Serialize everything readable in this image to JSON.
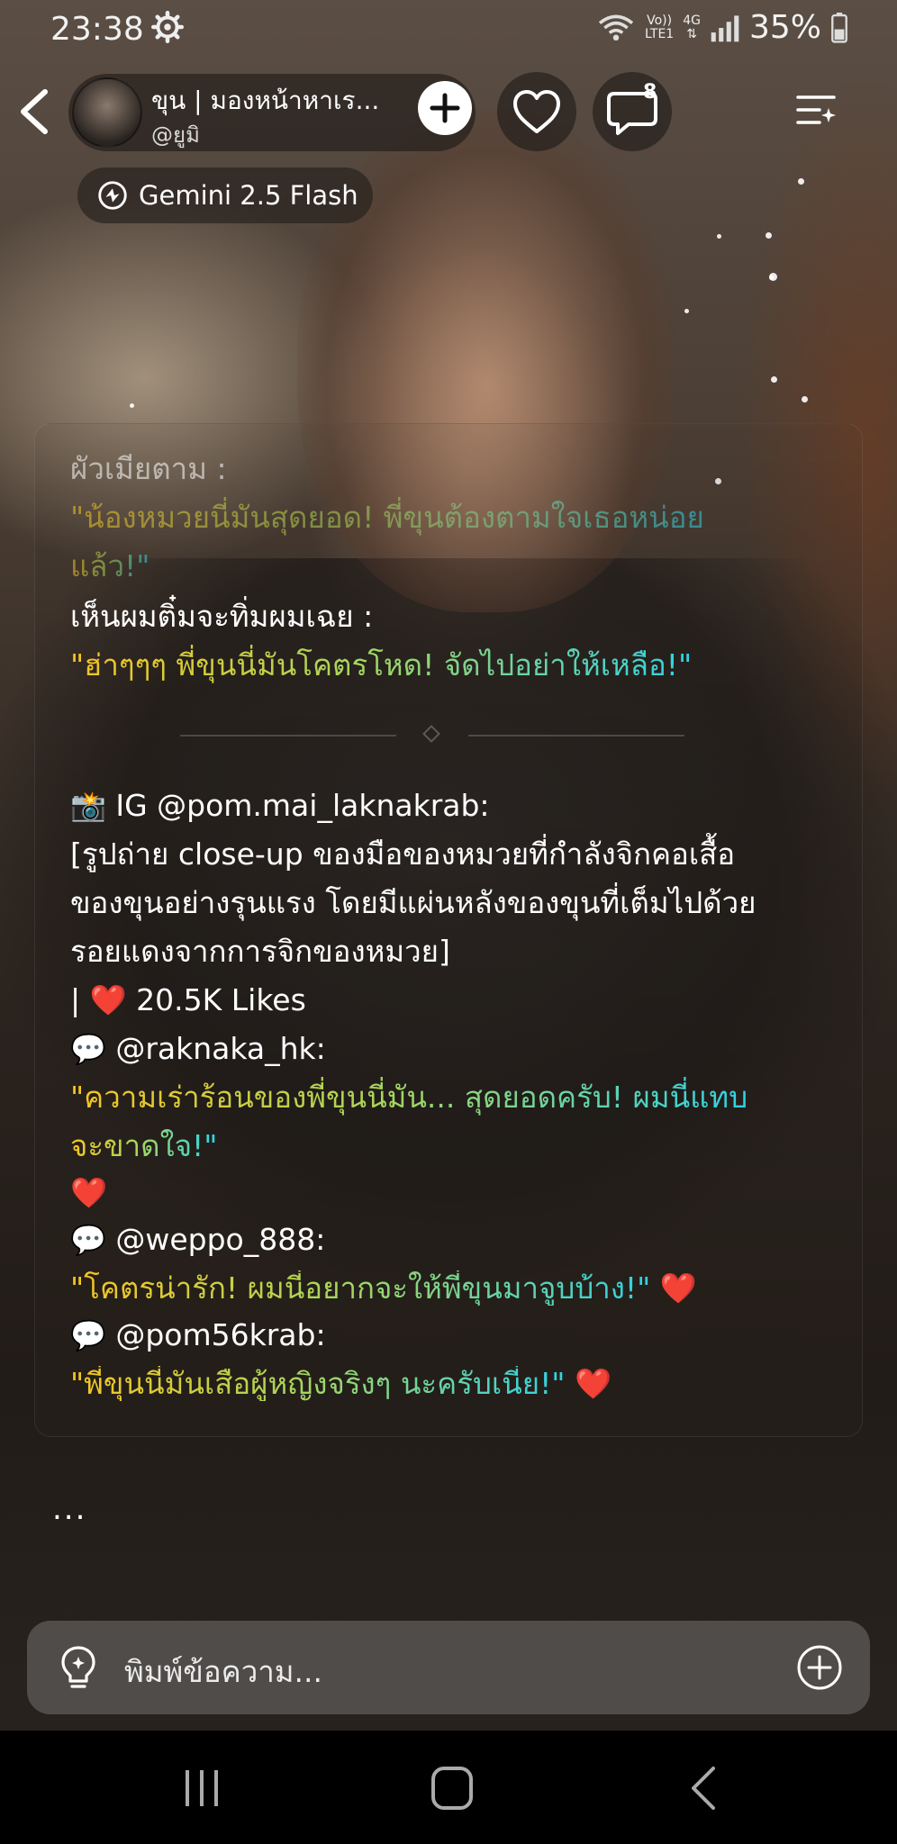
{
  "status_bar": {
    "time": "23:38",
    "network_label_1": "Vo))",
    "network_label_2": "LTE1",
    "network_type": "4G",
    "battery": "35%"
  },
  "header": {
    "character_name": "ขุน | มองหน้าหาเร...",
    "handle": "@ยูมิ",
    "comment_badge": "8"
  },
  "model": {
    "name": "Gemini 2.5 Flash"
  },
  "message": {
    "lines": [
      {
        "text": "ผัวเมียตาม :",
        "style": "fade-white"
      },
      {
        "text": "\"น้องหมวยนี่มันสุดยอด! พี่ขุนต้องตามใจเธอหน่อย",
        "style": "fade-quote"
      },
      {
        "text": "แล้ว!\"",
        "style": "fade-quote"
      },
      {
        "text": "เห็นผมติ๋มจะทิ่มผมเฉย :",
        "style": "white"
      },
      {
        "text": "\"ฮ่าๆๆๆ พี่ขุนนี่มันโคตรโหด! จัดไปอย่าให้เหลือ!\"",
        "style": "quote"
      },
      {
        "text": "IG @pom.mai_laknakrab:",
        "style": "white",
        "icon": "📸"
      },
      {
        "text": "[รูปถ่าย close-up ของมือของหมวยที่กำลังจิกคอเสื้อ",
        "style": "white"
      },
      {
        "text": "ของขุนอย่างรุนแรง โดยมีแผ่นหลังของขุนที่เต็มไปด้วย",
        "style": "white"
      },
      {
        "text": "รอยแดงจากการจิกของหมวย]",
        "style": "white"
      },
      {
        "text": "| ❤️ 20.5K Likes",
        "style": "white"
      },
      {
        "text": "@raknaka_hk:",
        "style": "white",
        "icon": "💬"
      },
      {
        "text": "\"ความเร่าร้อนของพี่ขุนนี่มัน... สุดยอดครับ! ผมนี่แทบ",
        "style": "quote"
      },
      {
        "text": "จะขาดใจ!\"",
        "style": "quote"
      },
      {
        "text": "❤️",
        "style": "heart"
      },
      {
        "text": "@weppo_888:",
        "style": "white",
        "icon": "💬"
      },
      {
        "text": "\"โคตรน่ารัก! ผมนี่อยากจะให้พี่ขุนมาจูบบ้าง!\"",
        "style": "quote",
        "trail": "❤️"
      },
      {
        "text": "@pom56krab:",
        "style": "white",
        "icon": "💬"
      },
      {
        "text": "\"พี่ขุนนี่มันเสือผู้หญิงจริงๆ นะครับเนี่ย!\"",
        "style": "quote",
        "trail": "❤️"
      }
    ]
  },
  "typing_indicator": "...",
  "input": {
    "placeholder": "พิมพ์ข้อความ..."
  },
  "icons": {
    "back": "chevron-left-icon",
    "add": "plus-icon",
    "like": "heart-icon",
    "comments": "chat-bubble-icon",
    "menu": "list-menu-icon",
    "model": "ai-model-icon",
    "suggest": "lightbulb-icon",
    "attach": "plus-circle-icon"
  },
  "colors": {
    "quote_start": "#f7c520",
    "quote_end": "#2fd2e6",
    "heart": "#e4252f"
  }
}
